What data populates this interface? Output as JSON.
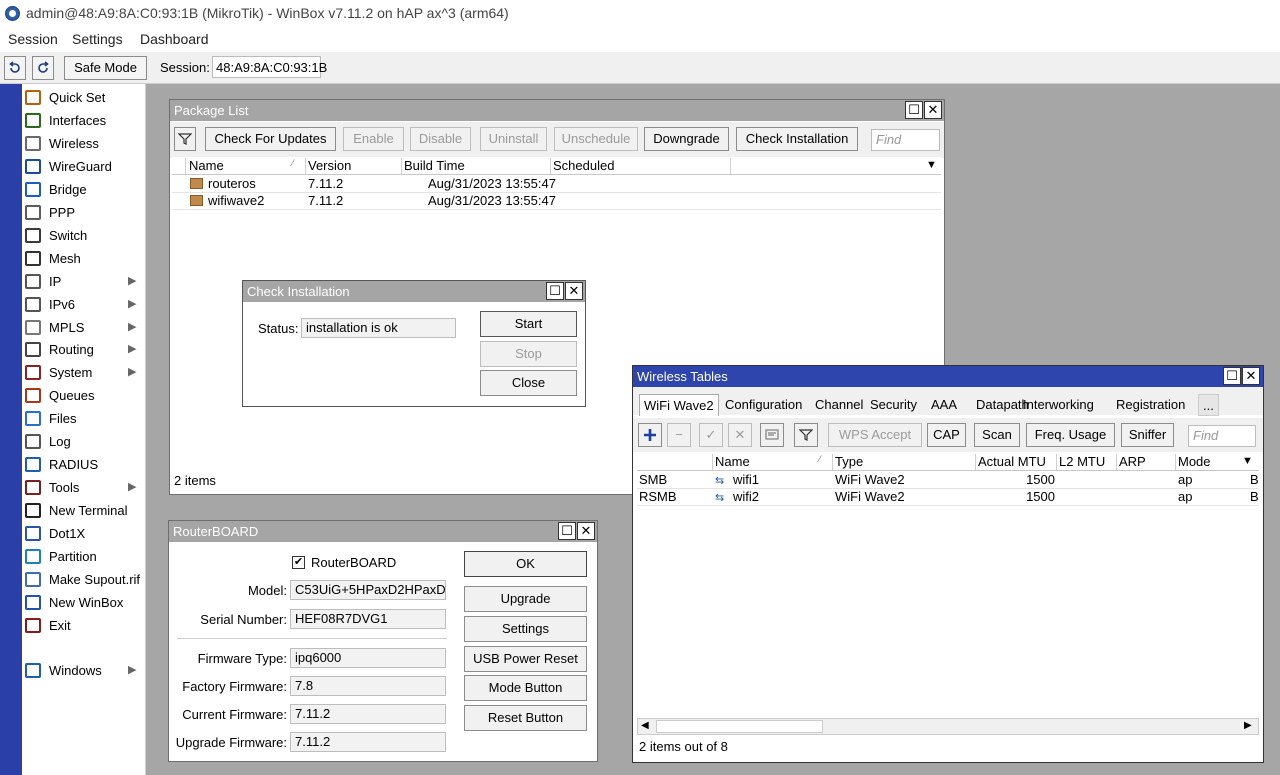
{
  "window_title": "admin@48:A9:8A:C0:93:1B (MikroTik) - WinBox v7.11.2 on hAP ax^3 (arm64)",
  "menu": [
    "Session",
    "Settings",
    "Dashboard"
  ],
  "toolbar": {
    "safe_mode": "Safe Mode",
    "session_label": "Session:",
    "session_value": "48:A9:8A:C0:93:1B"
  },
  "sidebar": {
    "items": [
      {
        "label": "Quick Set",
        "icon": "quick-set-icon"
      },
      {
        "label": "Interfaces",
        "icon": "interfaces-icon"
      },
      {
        "label": "Wireless",
        "icon": "wireless-icon"
      },
      {
        "label": "WireGuard",
        "icon": "wireguard-icon"
      },
      {
        "label": "Bridge",
        "icon": "bridge-icon"
      },
      {
        "label": "PPP",
        "icon": "ppp-icon"
      },
      {
        "label": "Switch",
        "icon": "switch-icon"
      },
      {
        "label": "Mesh",
        "icon": "mesh-icon"
      },
      {
        "label": "IP",
        "icon": "ip-icon",
        "arrow": "▶"
      },
      {
        "label": "IPv6",
        "icon": "ipv6-icon",
        "arrow": "▶"
      },
      {
        "label": "MPLS",
        "icon": "mpls-icon",
        "arrow": "▶"
      },
      {
        "label": "Routing",
        "icon": "routing-icon",
        "arrow": "▶"
      },
      {
        "label": "System",
        "icon": "system-icon",
        "arrow": "▶"
      },
      {
        "label": "Queues",
        "icon": "queues-icon"
      },
      {
        "label": "Files",
        "icon": "files-icon"
      },
      {
        "label": "Log",
        "icon": "log-icon"
      },
      {
        "label": "RADIUS",
        "icon": "radius-icon"
      },
      {
        "label": "Tools",
        "icon": "tools-icon",
        "arrow": "▶"
      },
      {
        "label": "New Terminal",
        "icon": "terminal-icon"
      },
      {
        "label": "Dot1X",
        "icon": "dot1x-icon"
      },
      {
        "label": "Partition",
        "icon": "partition-icon"
      },
      {
        "label": "Make Supout.rif",
        "icon": "supout-icon"
      },
      {
        "label": "New WinBox",
        "icon": "winbox-icon"
      },
      {
        "label": "Exit",
        "icon": "exit-icon"
      }
    ],
    "windows": {
      "label": "Windows",
      "arrow": "▶"
    }
  },
  "package_list": {
    "title": "Package List",
    "buttons": [
      {
        "label": "Check For Updates",
        "enabled": true
      },
      {
        "label": "Enable",
        "enabled": false
      },
      {
        "label": "Disable",
        "enabled": false
      },
      {
        "label": "Uninstall",
        "enabled": false
      },
      {
        "label": "Unschedule",
        "enabled": false
      },
      {
        "label": "Downgrade",
        "enabled": true
      },
      {
        "label": "Check Installation",
        "enabled": true
      }
    ],
    "find_placeholder": "Find",
    "columns": [
      "Name",
      "Version",
      "Build Time",
      "Scheduled"
    ],
    "rows": [
      {
        "name": "routeros",
        "version": "7.11.2",
        "build": "Aug/31/2023 13:55:47",
        "scheduled": ""
      },
      {
        "name": "wifiwave2",
        "version": "7.11.2",
        "build": "Aug/31/2023 13:55:47",
        "scheduled": ""
      }
    ],
    "status": "2 items"
  },
  "check_installation": {
    "title": "Check Installation",
    "status_label": "Status:",
    "status_value": "installation is ok",
    "buttons": {
      "start": "Start",
      "stop": "Stop",
      "close": "Close"
    }
  },
  "routerboard": {
    "title": "RouterBOARD",
    "checkbox_label": "RouterBOARD",
    "checked": true,
    "fields": [
      {
        "label": "Model:",
        "value": "C53UiG+5HPaxD2HPaxD"
      },
      {
        "label": "Serial Number:",
        "value": "HEF08R7DVG1"
      },
      {
        "label": "Firmware Type:",
        "value": "ipq6000"
      },
      {
        "label": "Factory Firmware:",
        "value": "7.8"
      },
      {
        "label": "Current Firmware:",
        "value": "7.11.2"
      },
      {
        "label": "Upgrade Firmware:",
        "value": "7.11.2"
      }
    ],
    "buttons": [
      "OK",
      "Upgrade",
      "Settings",
      "USB Power Reset",
      "Mode Button",
      "Reset Button"
    ]
  },
  "wireless_tables": {
    "title": "Wireless Tables",
    "tabs": [
      "WiFi Wave2",
      "Configuration",
      "Channel",
      "Security",
      "AAA",
      "Datapath",
      "Interworking",
      "Registration",
      "..."
    ],
    "toolbar_buttons": {
      "wps": "WPS Accept",
      "cap": "CAP",
      "scan": "Scan",
      "freq": "Freq. Usage",
      "sniffer": "Sniffer"
    },
    "find_placeholder": "Find",
    "columns": [
      "Name",
      "Type",
      "Actual MTU",
      "L2 MTU",
      "ARP",
      "Mode"
    ],
    "rows": [
      {
        "comment": "SMB",
        "name": "wifi1",
        "type": "WiFi Wave2",
        "mtu": "1500",
        "l2mtu": "",
        "arp": "",
        "mode": "ap",
        "extra": "B"
      },
      {
        "comment": "RSMB",
        "name": "wifi2",
        "type": "WiFi Wave2",
        "mtu": "1500",
        "l2mtu": "",
        "arp": "",
        "mode": "ap",
        "extra": "B"
      }
    ],
    "status": "2 items out of 8"
  },
  "colors": {
    "rail": "#2b3fa8",
    "active_title": "#2e45ad",
    "inactive_title": "#a5a5a5",
    "desktop": "#a6a6a6"
  }
}
